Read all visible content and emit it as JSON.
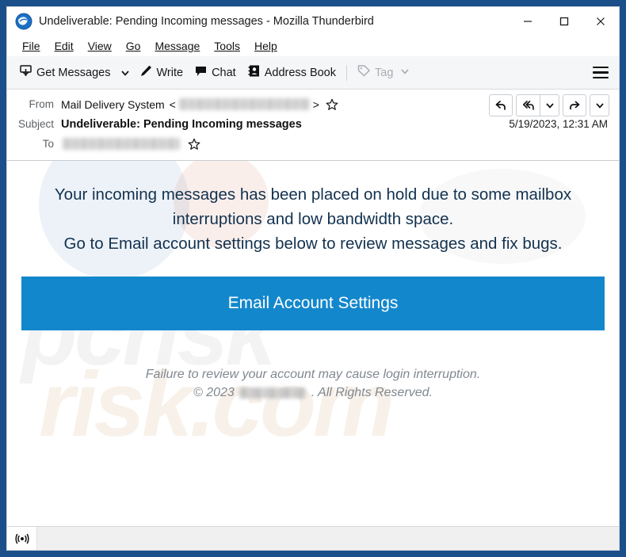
{
  "window": {
    "title": "Undeliverable: Pending Incoming messages - Mozilla Thunderbird",
    "app_icon": "thunderbird-icon",
    "controls": {
      "minimize": "minimize-icon",
      "maximize": "maximize-icon",
      "close": "close-icon"
    },
    "border_color": "#1b4f8a"
  },
  "menu_bar": {
    "items": [
      {
        "label": "File",
        "accesskey": "F"
      },
      {
        "label": "Edit",
        "accesskey": "E"
      },
      {
        "label": "View",
        "accesskey": "V"
      },
      {
        "label": "Go",
        "accesskey": "G"
      },
      {
        "label": "Message",
        "accesskey": "M"
      },
      {
        "label": "Tools",
        "accesskey": "T"
      },
      {
        "label": "Help",
        "accesskey": "H"
      }
    ]
  },
  "toolbar": {
    "get_messages": "Get Messages",
    "write": "Write",
    "chat": "Chat",
    "address_book": "Address Book",
    "tag": "Tag",
    "tag_disabled": true,
    "app_menu": "app-menu-icon"
  },
  "message_header": {
    "from_label": "From",
    "from_name": "Mail Delivery System",
    "from_email_redacted": true,
    "subject_label": "Subject",
    "subject": "Undeliverable: Pending Incoming messages",
    "to_label": "To",
    "to_email_redacted": true,
    "date": "5/19/2023, 12:31 AM",
    "actions": [
      {
        "name": "reply-button",
        "icon": "reply-icon"
      },
      {
        "name": "reply-all-button",
        "icon": "reply-all-icon"
      },
      {
        "name": "reply-menu-button",
        "icon": "chevron-down-icon"
      },
      {
        "name": "forward-button",
        "icon": "forward-icon"
      },
      {
        "name": "more-actions-button",
        "icon": "chevron-down-icon"
      }
    ]
  },
  "message_body": {
    "paragraph_line_1": "Your incoming messages has been placed on hold due to some mailbox",
    "paragraph_line_2": "interruptions and low bandwidth space.",
    "paragraph_line_3": "Go to Email account settings below to review messages and fix bugs.",
    "cta_label": "Email Account Settings",
    "cta_color": "#1387cc",
    "text_color": "#12324f",
    "footer_line_1": "Failure to review your account may cause login interruption.",
    "footer_copyright_prefix": "© 2023",
    "footer_company_redacted": true,
    "footer_copyright_suffix": ". All Rights Reserved."
  },
  "status_bar": {
    "icon": "broadcast-icon",
    "text": ""
  }
}
